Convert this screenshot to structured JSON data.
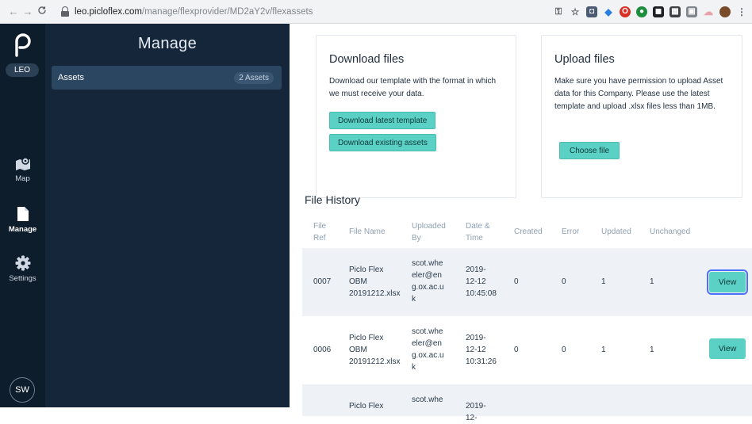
{
  "browser": {
    "back_icon": "←",
    "forward_icon": "→",
    "reload_icon": "C",
    "url_domain": "leo.picloflex.com",
    "url_path": "/manage/flexprovider/MD2aY2v/flexassets"
  },
  "rail": {
    "org_badge": "LEO",
    "items": [
      {
        "label": "Map",
        "icon": "map-icon"
      },
      {
        "label": "Manage",
        "icon": "file-icon"
      },
      {
        "label": "Settings",
        "icon": "gear-icon"
      }
    ],
    "avatar_initials": "SW"
  },
  "manage": {
    "title": "Manage",
    "assets_label": "Assets",
    "assets_count": "2 Assets"
  },
  "download": {
    "title": "Download files",
    "description": "Download our template with the format in which we must receive your data.",
    "template_button": "Download latest template",
    "existing_button": "Download existing assets"
  },
  "upload": {
    "title": "Upload files",
    "description": "Make sure you have permission to upload Asset data for this Company. Please use the latest template and upload .xlsx files less than 1MB.",
    "choose_button": "Choose file"
  },
  "file_history": {
    "title": "File History",
    "columns": [
      "File Ref",
      "File Name",
      "Uploaded By",
      "Date & Time",
      "Created",
      "Error",
      "Updated",
      "Unchanged"
    ],
    "rows": [
      {
        "ref": "0007",
        "name": "Piclo Flex OBM 20191212.xlsx",
        "by": "scot.wheeler@eng.ox.ac.uk",
        "date": "2019-12-12 10:45:08",
        "created": "0",
        "error": "0",
        "updated": "1",
        "unchanged": "1",
        "action": "View"
      },
      {
        "ref": "0006",
        "name": "Piclo Flex OBM 20191212.xlsx",
        "by": "scot.wheeler@eng.ox.ac.uk",
        "date": "2019-12-12 10:31:26",
        "created": "0",
        "error": "0",
        "updated": "1",
        "unchanged": "1",
        "action": "View"
      },
      {
        "ref": "",
        "name": "Piclo Flex",
        "by": "scot.whe",
        "date": "2019-12-",
        "created": "",
        "error": "",
        "updated": "",
        "unchanged": "",
        "action": ""
      }
    ]
  },
  "colors": {
    "rail_bg": "#0e1d2c",
    "manage_bg": "#16263a",
    "assets_row_bg": "#2b4661",
    "accent_teal": "#5bd0c4",
    "table_row_alt": "#eef2f6"
  }
}
